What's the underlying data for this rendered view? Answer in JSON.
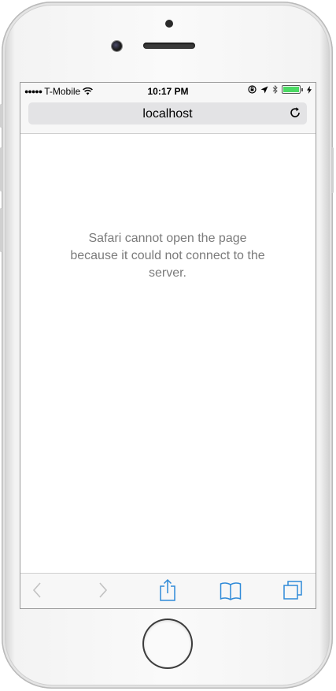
{
  "status_bar": {
    "signal": "●●●●●",
    "carrier": "T-Mobile",
    "time": "10:17 PM"
  },
  "address_bar": {
    "url": "localhost"
  },
  "page": {
    "error_message": "Safari cannot open the page because it could not connect to the server."
  },
  "toolbar": {
    "icons": [
      "back-icon",
      "forward-icon",
      "share-icon",
      "bookmarks-icon",
      "tabs-icon"
    ]
  },
  "colors": {
    "accent": "#2f8ad8",
    "disabled": "#c2c2c2",
    "message_text": "#7b7b7b",
    "battery": "#4cd964"
  }
}
